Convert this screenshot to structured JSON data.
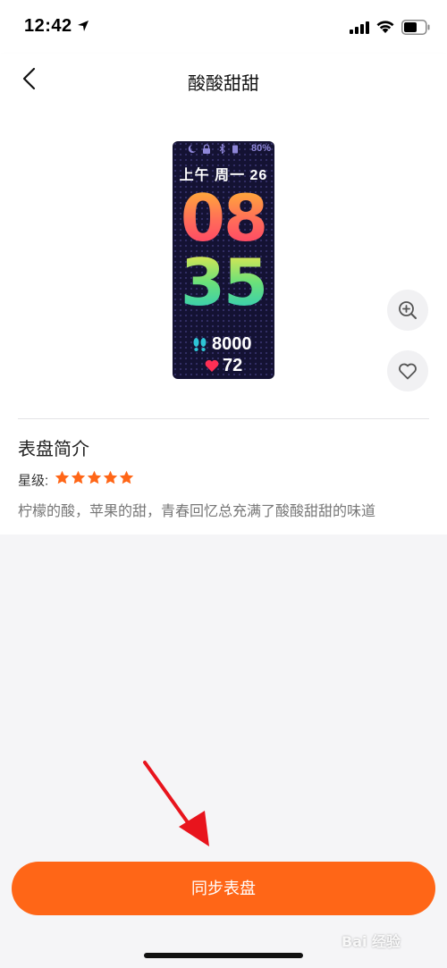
{
  "status_bar": {
    "time": "12:42"
  },
  "nav": {
    "title": "酸酸甜甜"
  },
  "watch_face": {
    "battery": "80%",
    "date": "上午 周一 26",
    "hours": "08",
    "minutes": "35",
    "steps": "8000",
    "heart_rate": "72"
  },
  "details": {
    "section_title": "表盘简介",
    "rating_label": "星级:",
    "rating": 5,
    "rating_max": 5,
    "description": "柠檬的酸，苹果的甜，青春回忆总充满了酸酸甜甜的味道"
  },
  "actions": {
    "sync_label": "同步表盘"
  },
  "watermark": "Bai 经验",
  "colors": {
    "accent": "#ff6617",
    "star": "#ff6617",
    "annotation_arrow": "#e8141d"
  }
}
